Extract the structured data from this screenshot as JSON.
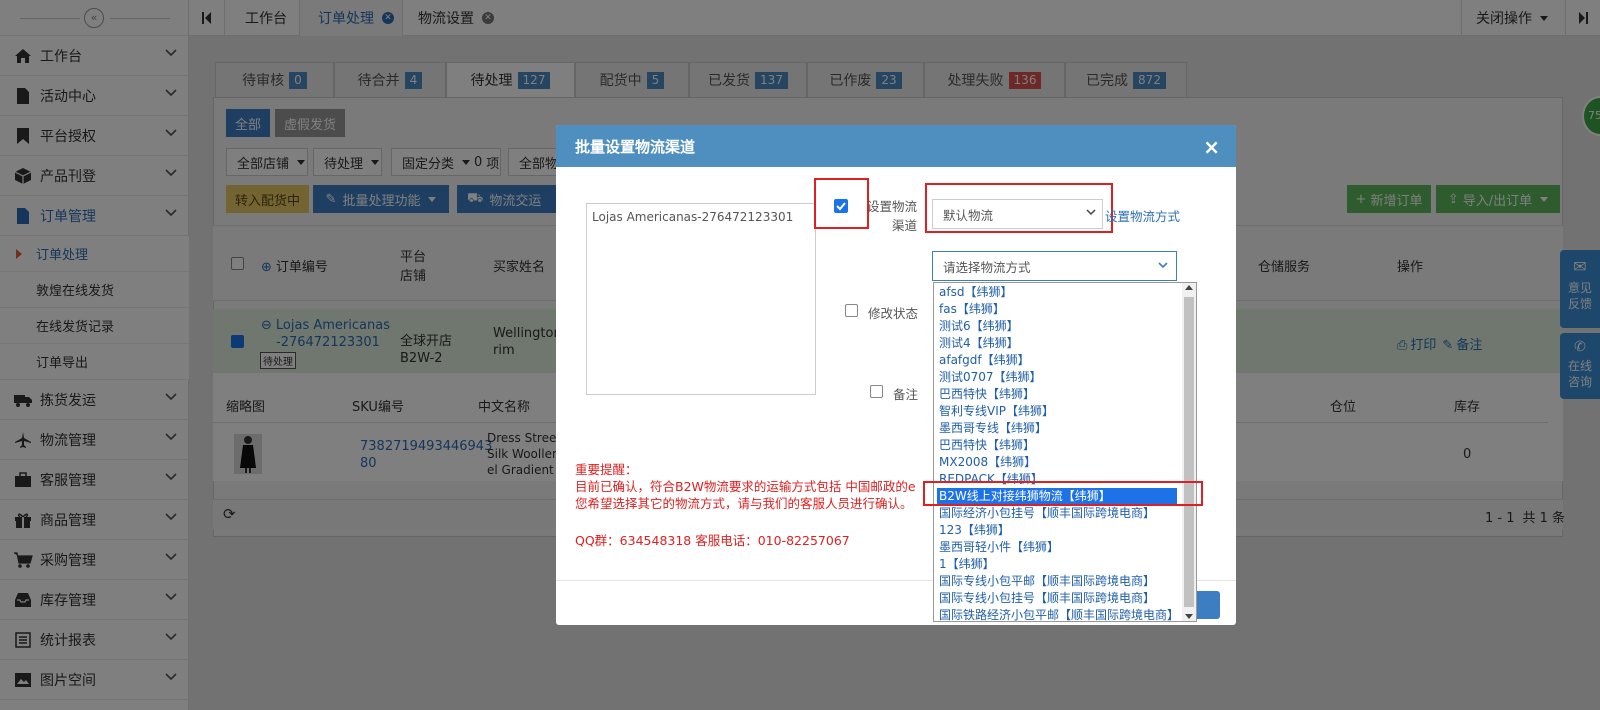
{
  "sidebar": {
    "collapse_icon": "«",
    "items": [
      {
        "label": "工作台",
        "icon": "home-icon"
      },
      {
        "label": "活动中心",
        "icon": "document-icon"
      },
      {
        "label": "平台授权",
        "icon": "bookmark-icon"
      },
      {
        "label": "产品刊登",
        "icon": "cube-icon"
      },
      {
        "label": "订单管理",
        "icon": "document-icon",
        "expanded": true
      },
      {
        "label": "拣货发运",
        "icon": "truck-icon"
      },
      {
        "label": "物流管理",
        "icon": "plane-icon"
      },
      {
        "label": "客服管理",
        "icon": "briefcase-icon"
      },
      {
        "label": "商品管理",
        "icon": "gift-icon"
      },
      {
        "label": "采购管理",
        "icon": "cart-icon"
      },
      {
        "label": "库存管理",
        "icon": "inbox-icon"
      },
      {
        "label": "统计报表",
        "icon": "list-icon"
      },
      {
        "label": "图片空间",
        "icon": "image-icon"
      }
    ],
    "sub_items": [
      "订单处理",
      "敦煌在线发货",
      "在线发货记录",
      "订单导出"
    ]
  },
  "tabbar": {
    "tabs": [
      {
        "label": "工作台"
      },
      {
        "label": "订单处理",
        "active": true
      },
      {
        "label": "物流设置"
      }
    ],
    "close_ops": "关闭操作"
  },
  "status_tabs": [
    {
      "label": "待审核",
      "count": "0"
    },
    {
      "label": "待合并",
      "count": "4"
    },
    {
      "label": "待处理",
      "count": "127",
      "active": true
    },
    {
      "label": "配货中",
      "count": "5"
    },
    {
      "label": "已发货",
      "count": "137"
    },
    {
      "label": "已作废",
      "count": "23"
    },
    {
      "label": "处理失败",
      "count": "136",
      "red": true
    },
    {
      "label": "已完成",
      "count": "872"
    }
  ],
  "filters": {
    "all": "全部",
    "virtual": "虚假发货",
    "all_stores": "全部店铺",
    "pending": "待处理",
    "fixed_cat": "固定分类",
    "fixed_count": "0",
    "fixed_unit": "项",
    "all_logistics": "全部物"
  },
  "actions": {
    "to_picking": "转入配货中",
    "batch": "批量处理功能",
    "logistics_deliver": "物流交运",
    "new_order": "新增订单",
    "import_export": "导入/出订单"
  },
  "table": {
    "headers": {
      "order_no": "订单编号",
      "platform": "平台",
      "store": "店铺",
      "buyer": "买家姓名",
      "warehouse": "仓储服务",
      "ops": "操作"
    },
    "order": {
      "store_name": "Lojas Americanas",
      "order_id": "-276472123301",
      "status_tag": "待处理",
      "store": "全球开店B2W-2",
      "buyer": "Wellington",
      "buyer2": "rim",
      "print": "打印",
      "note": "备注"
    },
    "item_headers": {
      "thumb": "缩略图",
      "sku": "SKU编号",
      "cn_name": "中文名称",
      "location": "仓位",
      "stock": "库存"
    },
    "item": {
      "sku": "7382719493446943",
      "sku2": "80",
      "name1": "Dress Street",
      "name2": "Silk Woollen",
      "name3": "el Gradient",
      "stock": "0"
    },
    "pagination": {
      "range": "1 - 1",
      "total": "共 1 条"
    }
  },
  "float": {
    "circle": "75",
    "feedback": "意见反馈",
    "consult": "在线咨询"
  },
  "modal": {
    "title": "批量设置物流渠道",
    "order": "Lojas Americanas-276472123301",
    "set_channel_label": "设置物流渠道",
    "default_logistics": "默认物流",
    "set_method": "设置物流方式",
    "choose_placeholder": "请选择物流方式",
    "modify_status": "修改状态",
    "remark": "备注",
    "notice_title": "重要提醒：",
    "notice_1": "目前已确认，符合B2W物流要求的运输方式包括 中国邮政的e",
    "notice_2": "您希望选择其它的物流方式，请与我们的客服人员进行确认。",
    "contact": "QQ群：634548318 客服电话：010-82257067",
    "options": [
      "afsd【纬狮】",
      "fas【纬狮】",
      "测试6【纬狮】",
      "测试4【纬狮】",
      "afafgdf【纬狮】",
      "测试0707【纬狮】",
      "巴西特快【纬狮】",
      "智利专线VIP【纬狮】",
      "墨西哥专线【纬狮】",
      "巴西特快【纬狮】",
      "MX2008【纬狮】",
      "REDPACK【纬狮】",
      "B2W线上对接纬狮物流【纬狮】",
      "国际经济小包挂号【顺丰国际跨境电商】",
      "123【纬狮】",
      "墨西哥轻小件【纬狮】",
      "1【纬狮】",
      "国际专线小包平邮【顺丰国际跨境电商】",
      "国际专线小包挂号【顺丰国际跨境电商】",
      "国际铁路经济小包平邮【顺丰国际跨境电商】"
    ],
    "highlighted_index": 12
  }
}
